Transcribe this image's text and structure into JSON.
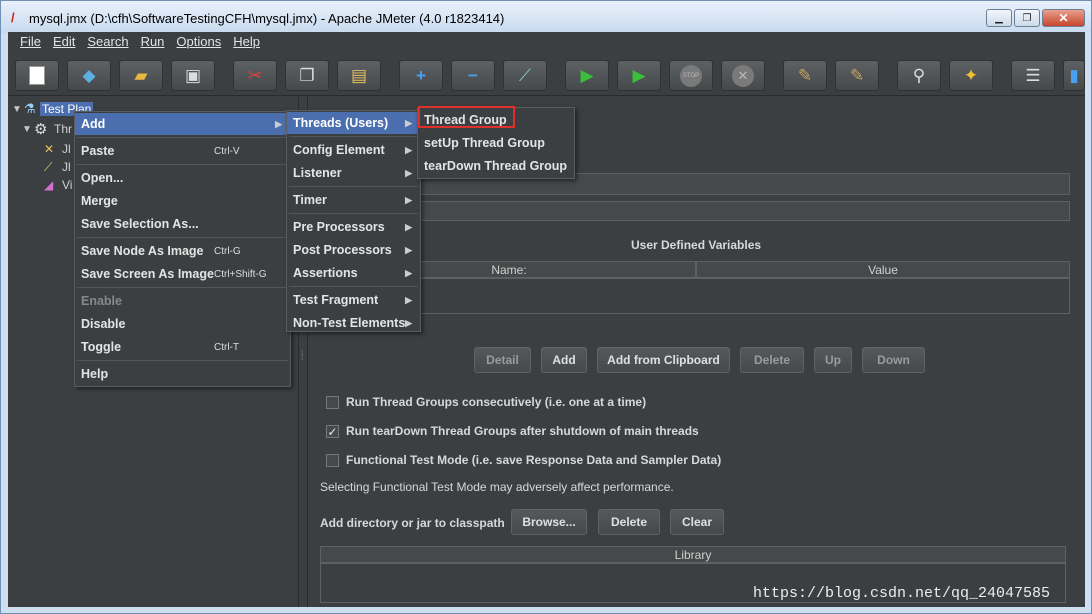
{
  "window": {
    "title": "mysql.jmx (D:\\cfh\\SoftwareTestingCFH\\mysql.jmx) - Apache JMeter (4.0 r1823414)",
    "controls": [
      "▁",
      "❐",
      "✕"
    ]
  },
  "menubar": [
    "File",
    "Edit",
    "Search",
    "Run",
    "Options",
    "Help"
  ],
  "toolbar_icons": [
    "new-icon",
    "templates-icon",
    "open-icon",
    "save-icon",
    "cut-icon",
    "copy-icon",
    "paste-icon",
    "expand-icon",
    "collapse-icon",
    "toggle-icon",
    "start-icon",
    "start-no-pause-icon",
    "stop-icon",
    "shutdown-icon",
    "clear-icon",
    "clear-all-icon",
    "search-icon",
    "reset-search-icon",
    "function-helper-icon",
    "help-icon"
  ],
  "tree": {
    "root": "Test Plan",
    "children": [
      "Thr",
      "Jl",
      "Jl",
      "Vi"
    ]
  },
  "context_menu": {
    "items": [
      {
        "label": "Add",
        "shortcut": "",
        "submenu": true,
        "highlighted": true
      },
      {
        "label": "Paste",
        "shortcut": "Ctrl-V"
      },
      {
        "label": "Open...",
        "shortcut": ""
      },
      {
        "label": "Merge",
        "shortcut": ""
      },
      {
        "label": "Save Selection As...",
        "shortcut": ""
      },
      {
        "label": "Save Node As Image",
        "shortcut": "Ctrl-G"
      },
      {
        "label": "Save Screen As Image",
        "shortcut": "Ctrl+Shift-G"
      },
      {
        "label": "Enable",
        "shortcut": "",
        "disabled": true
      },
      {
        "label": "Disable",
        "shortcut": ""
      },
      {
        "label": "Toggle",
        "shortcut": "Ctrl-T"
      },
      {
        "label": "Help",
        "shortcut": ""
      }
    ]
  },
  "add_submenu": {
    "items": [
      "Threads (Users)",
      "Config Element",
      "Listener",
      "Timer",
      "Pre Processors",
      "Post Processors",
      "Assertions",
      "Test Fragment",
      "Non-Test Elements"
    ]
  },
  "threads_submenu": {
    "items": [
      "Thread Group",
      "setUp Thread Group",
      "tearDown Thread Group"
    ],
    "selected": "Thread Group"
  },
  "test_plan_panel": {
    "variables_title": "User Defined Variables",
    "table_headers": [
      "Name:",
      "Value"
    ],
    "buttons": [
      "Detail",
      "Add",
      "Add from Clipboard",
      "Delete",
      "Up",
      "Down"
    ],
    "checkboxes": [
      {
        "label": "Run Thread Groups consecutively (i.e. one at a time)",
        "checked": false
      },
      {
        "label": "Run tearDown Thread Groups after shutdown of main threads",
        "checked": true
      },
      {
        "label": "Functional Test Mode (i.e. save Response Data and Sampler Data)",
        "checked": false
      }
    ],
    "functional_note": "Selecting Functional Test Mode may adversely affect performance.",
    "classpath_label": "Add directory or jar to classpath",
    "classpath_buttons": [
      "Browse...",
      "Delete",
      "Clear"
    ],
    "library_header": "Library"
  },
  "watermark": "https://blog.csdn.net/qq_24047585"
}
